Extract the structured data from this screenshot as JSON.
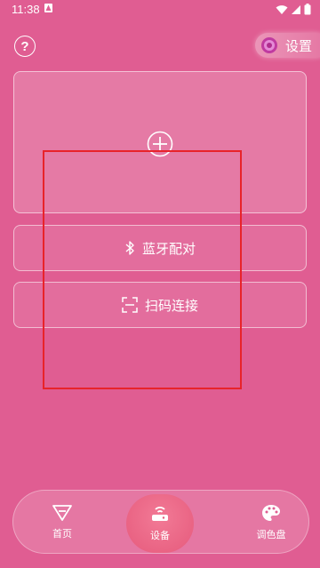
{
  "status_bar": {
    "time": "11:38"
  },
  "header": {
    "settings_label": "设置"
  },
  "actions": {
    "bluetooth_label": "蓝牙配对",
    "scan_label": "扫码连接"
  },
  "bottom_nav": {
    "items": [
      {
        "label": "首页"
      },
      {
        "label": "设备"
      },
      {
        "label": "调色盘"
      }
    ]
  },
  "colors": {
    "background": "#e05d92",
    "highlight": "#e8232a",
    "active_tab": "#f06c89"
  }
}
